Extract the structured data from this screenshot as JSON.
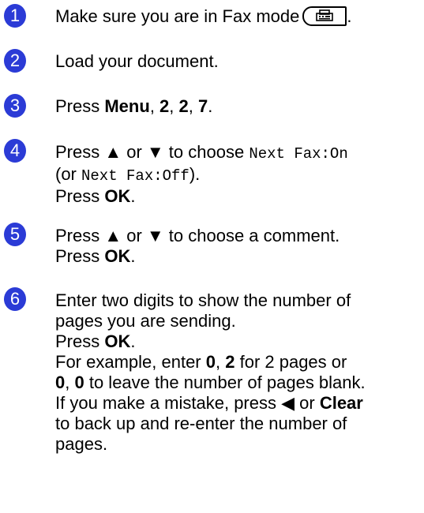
{
  "steps": [
    {
      "number": "1",
      "parts": {
        "text": "Make sure you are in Fax mode",
        "period": "."
      },
      "icon": "fax-icon"
    },
    {
      "number": "2",
      "text": "Load your document."
    },
    {
      "number": "3",
      "parts": {
        "press": "Press ",
        "menu": "Menu",
        "sep1": ", ",
        "k1": "2",
        "sep2": ", ",
        "k2": "2",
        "sep3": ", ",
        "k3": "7",
        "end": "."
      }
    },
    {
      "number": "4",
      "parts": {
        "l1a": "Press ▲ or ▼ to choose ",
        "code1": "Next Fax:On",
        "l2a": "(or ",
        "code2": "Next Fax:Off",
        "l2b": ").",
        "l3a": "Press ",
        "ok": "OK",
        "l3b": "."
      }
    },
    {
      "number": "5",
      "parts": {
        "l1": "Press ▲ or ▼ to choose a comment.",
        "l2a": "Press ",
        "ok": "OK",
        "l2b": "."
      }
    },
    {
      "number": "6",
      "parts": {
        "l1": "Enter two digits to show the number of",
        "l2": "pages you are sending.",
        "l3a": "Press ",
        "ok": "OK",
        "l3b": ".",
        "l4a": "For example, enter ",
        "d0": "0",
        ", ": ", ",
        "d2": "2",
        "l4b": " for 2 pages or",
        "l5d0": "0",
        "l5sep": ", ",
        "l5d1": "0",
        "l5b": " to leave the number of pages blank.",
        "l6a": "If you make a mistake, press ◀ or ",
        "clear": "Clear",
        "l7": "to back up and re-enter the number of",
        "l8": "pages."
      }
    }
  ]
}
